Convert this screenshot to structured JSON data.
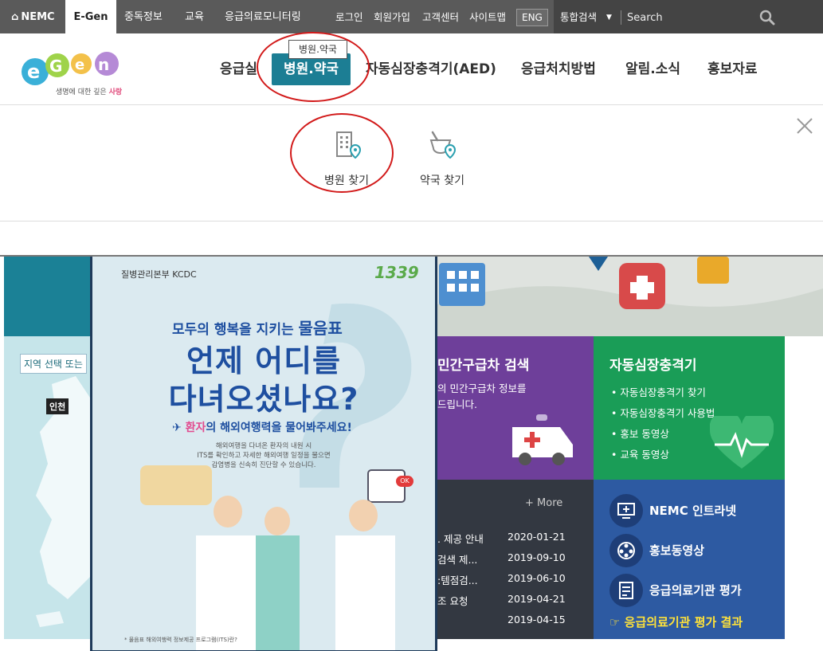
{
  "colors": {
    "topbar": "#5a5a5a",
    "nav_active": "#1c7e94",
    "tile_purple": "#6e3f9a",
    "tile_green": "#1a9d57",
    "tile_dark": "#333841",
    "tile_blue": "#2d5aa2",
    "annotation_red": "#d21a1a"
  },
  "topbar": {
    "home_label": "NEMC",
    "egen_label": "E-Gen",
    "items": [
      "중독정보",
      "교육",
      "응급의료모니터링"
    ],
    "login": "로그인",
    "signup": "회원가입",
    "support": "고객센터",
    "sitemap": "사이트맵",
    "eng": "ENG",
    "search_scope": "통합검색",
    "search_placeholder": "Search"
  },
  "header": {
    "logo_text": "e-Gen",
    "logo_tagline_prefix": "생명에 대한 깊은",
    "logo_tagline_emph": "사랑",
    "nav": [
      "응급실",
      "병원.약국",
      "자동심장충격기(AED)",
      "응급처치방법",
      "알림.소식",
      "홍보자료"
    ],
    "tooltip": "병원.약국"
  },
  "dropdown": {
    "items": [
      {
        "label": "병원 찾기",
        "icon": "hospital-location-icon"
      },
      {
        "label": "약국 찾기",
        "icon": "pharmacy-location-icon"
      }
    ]
  },
  "left_panel": {
    "region_label": "지역 선택 또는",
    "city_badge": "인천"
  },
  "poster": {
    "org": "질병관리본부 KCDC",
    "hotline": "1339",
    "subtitle_prefix": "모두의 행복을 지키는",
    "subtitle_emph": "물음표",
    "headline1": "언제 어디를",
    "headline2": "다녀오셨나요?",
    "sub2_emph": "환자",
    "sub2_rest": "의 해외여행력을 물어봐주세요!",
    "small1": "해외여행을 다녀온 환자의 내원 시",
    "small2": "ITS를 확인하고 자세한 해외여행 일정을 물으면",
    "small3": "감염병을 신속히 진단할 수 있습니다.",
    "badge": "OK",
    "footnote": "* 물음표 해외여행력 정보제공 프로그램(ITS)란?"
  },
  "tiles": {
    "purple": {
      "title": "민간구급차 검색",
      "line1": "의 민간구급차 정보를",
      "line2": "드립니다."
    },
    "green": {
      "title": "자동심장충격기",
      "items": [
        "자동심장충격기 찾기",
        "자동심장충격기 사용법",
        "홍보 동영상",
        "교육 동영상"
      ]
    },
    "dark": {
      "more": "+ More",
      "notices": [
        {
          "title": ". 제공 안내",
          "date": "2020-01-21"
        },
        {
          "title": "검색 제...",
          "date": "2019-09-10"
        },
        {
          "title": ":템점검...",
          "date": "2019-06-10"
        },
        {
          "title": "조 요청",
          "date": "2019-04-21"
        },
        {
          "title": "",
          "date": "2019-04-15"
        }
      ]
    },
    "blue": {
      "links": [
        "NEMC 인트라넷",
        "홍보동영상",
        "응급의료기관 평가"
      ],
      "result": "☞ 응급의료기관 평가 결과"
    }
  }
}
